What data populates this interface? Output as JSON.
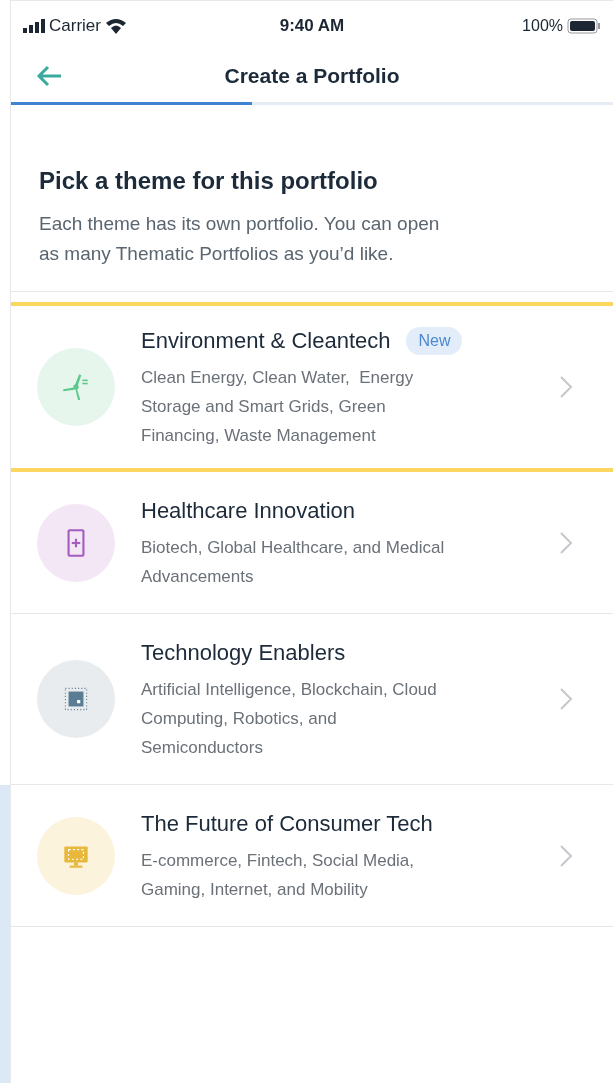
{
  "status_bar": {
    "carrier": "Carrier",
    "time": "9:40 AM",
    "battery": "100%"
  },
  "header": {
    "title": "Create a Portfolio"
  },
  "progress": {
    "level": 0.4
  },
  "intro": {
    "heading": "Pick a theme for this portfolio",
    "lines": [
      "Each theme has its own portfolio. You can open",
      "as many Thematic Portfolios as you’d like."
    ]
  },
  "themes": [
    {
      "title": "Environment & Cleantech",
      "badge": "New",
      "description_lines": [
        "Clean Energy, Clean Water,  Energy",
        "Storage and Smart Grids, Green",
        "Financing, Waste Management"
      ],
      "kind": "windmill",
      "selected": true
    },
    {
      "title": "Healthcare Innovation",
      "description_lines": [
        "Biotech, Global Healthcare, and Medical",
        "Advancements"
      ],
      "kind": "phone",
      "selected": false
    },
    {
      "title": "Technology Enablers",
      "description_lines": [
        "Artificial Intelligence, Blockchain, Cloud",
        "Computing, Robotics, and",
        "Semiconductors"
      ],
      "kind": "chip",
      "selected": false
    },
    {
      "title": "The Future of Consumer Tech",
      "description_lines": [
        "E-commerce, Fintech, Social Media,",
        "Gaming, Internet, and Mobility"
      ],
      "kind": "monitor",
      "selected": false
    }
  ]
}
